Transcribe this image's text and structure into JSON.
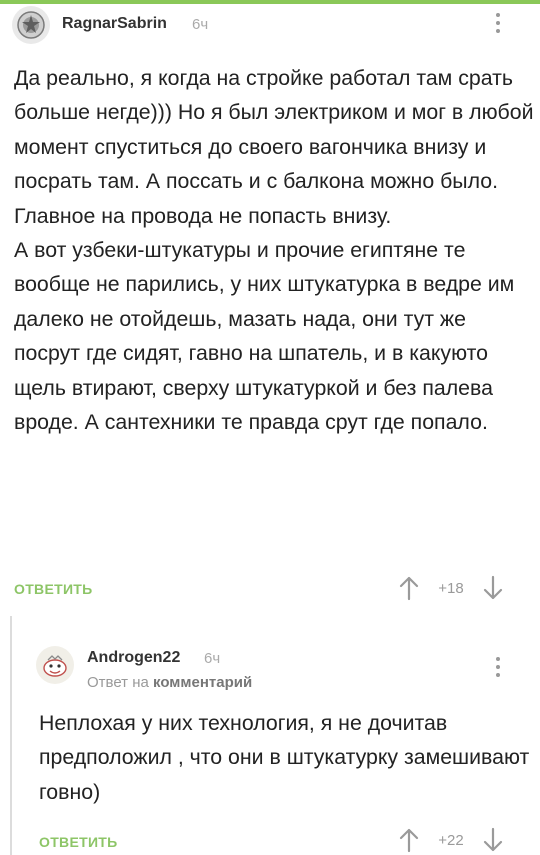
{
  "main_comment": {
    "author": "RagnarSabrin",
    "time": "6ч",
    "text": "Да реально, я когда на стройке работал там срать больше негде))) Но я был электриком и мог в любой момент спуститься до своего вагончика внизу и посрать там. А поссать и с балкона можно было. Главное на провода не попасть внизу.\nА вот узбеки-штукатуры и прочие египтяне те вообще не парились, у них штукатурка в ведре им далеко не отойдешь, мазать нада, они тут же посрут где сидят, гавно на шпатель, и в какуюто щель втирают, сверху штукатуркой и без палева вроде. А сантехники те правда срут где попало.",
    "reply_label": "ОТВЕТИТЬ",
    "score": "+18"
  },
  "reply_comment": {
    "author": "Androgen22",
    "time": "6ч",
    "reply_to_prefix": "Ответ на",
    "reply_to_target": "комментарий",
    "text": "Неплохая у них технология, я не дочитав предположил , что они в штукатурку замешивают говно)",
    "reply_label": "ОТВЕТИТЬ",
    "score": "+22"
  },
  "colors": {
    "accent": "#8dc567",
    "muted": "#999999",
    "text": "#222222"
  },
  "icons": {
    "more": "kebab-menu-icon",
    "upvote": "arrow-up-icon",
    "downvote": "arrow-down-icon"
  }
}
